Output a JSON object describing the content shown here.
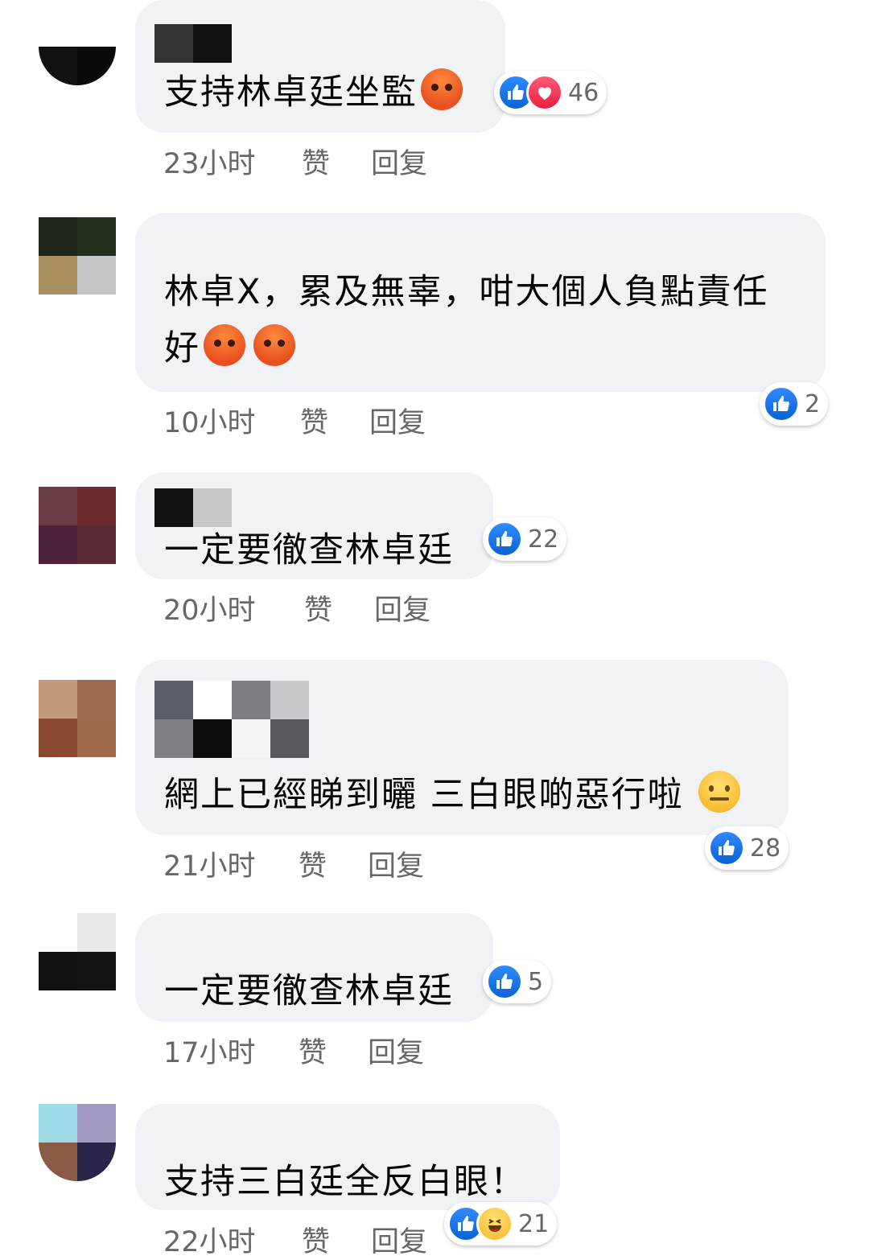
{
  "comments": [
    {
      "text": "支持林卓廷坐監",
      "emojis": [
        "angry"
      ],
      "reaction_types": [
        "like",
        "love"
      ],
      "reaction_count": "46",
      "time": "23小时",
      "like_label": "赞",
      "reply_label": "回复"
    },
    {
      "text_line1": "林卓X，累及無辜，咁大個人負點責任",
      "text_line2": "好",
      "emojis": [
        "angry",
        "angry"
      ],
      "reaction_types": [
        "like"
      ],
      "reaction_count": "2",
      "time": "10小时",
      "like_label": "赞",
      "reply_label": "回复"
    },
    {
      "text": "一定要徹查林卓廷",
      "reaction_types": [
        "like"
      ],
      "reaction_count": "22",
      "time": "20小时",
      "like_label": "赞",
      "reply_label": "回复"
    },
    {
      "text": "網上已經睇到曬 三白眼啲惡行啦",
      "emojis": [
        "neutral"
      ],
      "reaction_types": [
        "like"
      ],
      "reaction_count": "28",
      "time": "21小时",
      "like_label": "赞",
      "reply_label": "回复"
    },
    {
      "text": "一定要徹查林卓廷",
      "reaction_types": [
        "like"
      ],
      "reaction_count": "5",
      "time": "17小时",
      "like_label": "赞",
      "reply_label": "回复"
    },
    {
      "text": "支持三白廷全反白眼！",
      "reaction_types": [
        "like",
        "haha"
      ],
      "reaction_count": "21",
      "time": "22小时",
      "like_label": "赞",
      "reply_label": "回复"
    }
  ],
  "colors": {
    "bubble": "#f0f2f5",
    "text": "#050505",
    "meta": "#65676b",
    "like_blue": "#1877f2",
    "love_red": "#f33e58",
    "angry_orange": "#e8501f"
  }
}
